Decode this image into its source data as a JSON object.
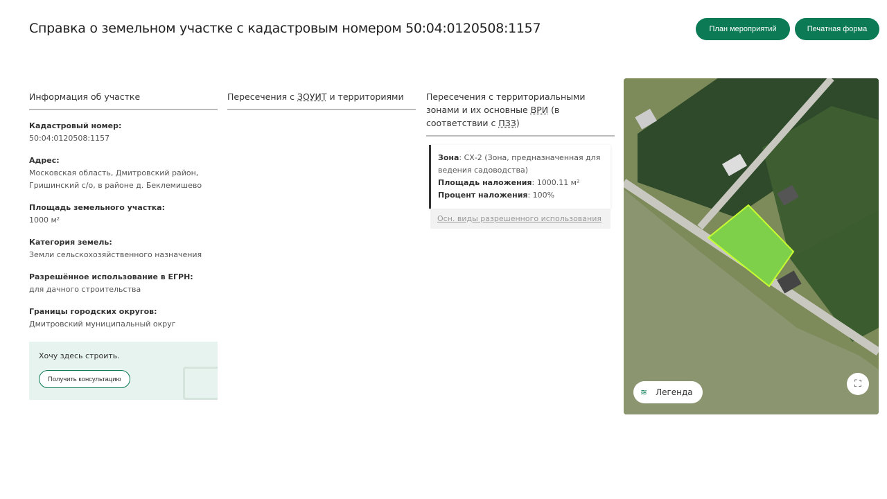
{
  "title": "Справка о земельном участке с кадастровым номером 50:04:0120508:1157",
  "buttons": {
    "plan": "План мероприятий",
    "print": "Печатная форма"
  },
  "info": {
    "heading": "Информация об участке",
    "fields": [
      {
        "k": "Кадастровый номер:",
        "v": "50:04:0120508:1157"
      },
      {
        "k": "Адрес:",
        "v": "Московская область, Дмитровский район, Гришинский с/о, в районе д. Беклемишево"
      },
      {
        "k": "Площадь земельного участка:",
        "v": "1000 м²"
      },
      {
        "k": "Категория земель:",
        "v": "Земли сельскохозяйственного назначения"
      },
      {
        "k": "Разрешённое использование в ЕГРН:",
        "v": "для дачного строительства"
      },
      {
        "k": "Границы городских округов:",
        "v": "Дмитровский муниципальный округ"
      }
    ],
    "cta": {
      "text": "Хочу здесь строить.",
      "button": "Получить консультацию"
    }
  },
  "zouit": {
    "pre": "Пересечения с ",
    "abbr": "ЗОУИТ",
    "post": " и территориями"
  },
  "zones": {
    "h1": "Пересечения с территориальными зонами и их основные ",
    "abbr1": "ВРИ",
    "h2": " (в соответствии с ",
    "abbr2": "ПЗЗ",
    "h3": ")",
    "zone_k": "Зона",
    "zone_v": ": СХ-2 (Зона, предназначенная для ведения садоводства)",
    "area_k": "Площадь наложения",
    "area_v": ": 1000.11 м²",
    "pct_k": "Процент наложения",
    "pct_v": ": 100%",
    "link": "Осн. виды разрешенного использования"
  },
  "map": {
    "legend": "Легенда"
  }
}
